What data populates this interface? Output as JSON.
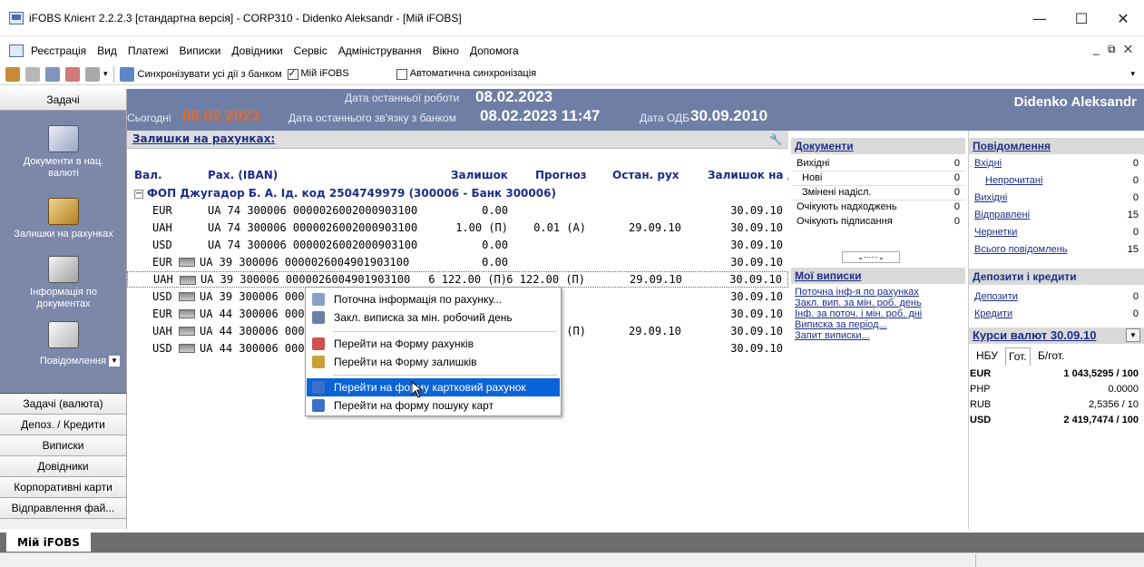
{
  "window": {
    "title": "iFOBS Клієнт 2.2.2.3 [стандартна версія] - CORP310 - Didenko Aleksandr - [Мій iFOBS]",
    "controls": [
      "—",
      "☐",
      "✕"
    ]
  },
  "menu": {
    "items": [
      "Реєстрація",
      "Вид",
      "Платежі",
      "Виписки",
      "Довідники",
      "Сервіс",
      "Адміністрування",
      "Вікно",
      "Допомога"
    ],
    "mdi": "_ ⧉ ✕"
  },
  "toolbar": {
    "sync_label": "Синхронізувати усі дії з банком",
    "my_ifobs_label": "Мій iFOBS",
    "auto_sync_label": "Автоматична синхронізація"
  },
  "sidebar": {
    "header": "Задачі",
    "nav": [
      {
        "label": "Документи в нац. валюті"
      },
      {
        "label": "Залишки на рахунках"
      },
      {
        "label": "Інформація по документах"
      },
      {
        "label": "Повідомлення"
      }
    ],
    "buttons": [
      "Задачі (валюта)",
      "Депоз. / Кредити",
      "Виписки",
      "Довідники",
      "Корпоративні карти",
      "Відправлення фай..."
    ]
  },
  "band": {
    "last_work_label": "Дата останньої роботи",
    "last_work": "08.02.2023",
    "today_label": "Сьогодні",
    "today": "08.02.2023",
    "last_conn_label": "Дата останнього зв'язку з банком",
    "last_conn": "08.02.2023 11:47",
    "odb_label": "Дата ОДБ",
    "odb": "30.09.2010",
    "user": "Didenko Aleksandr"
  },
  "balances": {
    "header": "Залишки на рахунках:",
    "columns": [
      "Вал.",
      "Рах. (IBAN)",
      "Залишок",
      "Прогноз",
      "Остан. рух",
      "Залишок на да"
    ],
    "group": "ФОП Джугадор Б. А. Ід. код 2504749979 (300006 - Банк 300006)",
    "rows": [
      {
        "cur": "EUR",
        "card": false,
        "iban": "UA 74 300006 0000026002000903100",
        "bal": "0.00",
        "fc": "",
        "last": "",
        "date": "30.09.10"
      },
      {
        "cur": "UAH",
        "card": false,
        "iban": "UA 74 300006 0000026002000903100",
        "bal": "1.00 (П)",
        "fc": "0.01 (А)",
        "last": "29.09.10",
        "date": "30.09.10"
      },
      {
        "cur": "USD",
        "card": false,
        "iban": "UA 74 300006 0000026002000903100",
        "bal": "0.00",
        "fc": "",
        "last": "",
        "date": "30.09.10"
      },
      {
        "cur": "EUR",
        "card": true,
        "iban": "UA 39 300006 0000026004901903100",
        "bal": "0.00",
        "fc": "",
        "last": "",
        "date": "30.09.10"
      },
      {
        "cur": "UAH",
        "card": true,
        "iban": "UA 39 300006 0000026004901903100",
        "bal": "6 122.00 (П)",
        "fc": "6 122.00 (П)",
        "last": "29.09.10",
        "date": "30.09.10"
      },
      {
        "cur": "USD",
        "card": true,
        "iban": "UA 39 300006 000",
        "bal": "",
        "fc": "",
        "last": "",
        "date": "30.09.10"
      },
      {
        "cur": "EUR",
        "card": true,
        "iban": "UA 44 300006 000",
        "bal": "",
        "fc": "",
        "last": "",
        "date": "30.09.10"
      },
      {
        "cur": "UAH",
        "card": true,
        "iban": "UA 44 300006 000",
        "bal": "",
        "fc": "0 (П)",
        "last": "29.09.10",
        "date": "30.09.10"
      },
      {
        "cur": "USD",
        "card": true,
        "iban": "UA 44 300006 000",
        "bal": "",
        "fc": "",
        "last": "",
        "date": "30.09.10"
      }
    ]
  },
  "context_menu": {
    "items": [
      {
        "label": "Поточна інформація по рахунку...",
        "color": "#8aa0c8"
      },
      {
        "label": "Закл. виписка за мін. робочий день",
        "color": "#6b7fa8"
      },
      {
        "label": "Перейти на Форму рахунків",
        "color": "#d05050"
      },
      {
        "label": "Перейти на Форму залишків",
        "color": "#c9a23a"
      },
      {
        "label": "Перейти на форму картковий рахунок",
        "color": "#3b6fc8"
      },
      {
        "label": "Перейти на форму пошуку карт",
        "color": "#3b6fc8"
      }
    ]
  },
  "documents": {
    "header": "Документи",
    "rows": [
      {
        "k": "Вихідні",
        "v": "0"
      },
      {
        "k": "Нові",
        "v": "0"
      },
      {
        "k": "Змінені надісл.",
        "v": "0"
      },
      {
        "k": "Очікують надходжень",
        "v": "0"
      },
      {
        "k": "Очікують підписання",
        "v": "0"
      }
    ],
    "expander": "⌄⋯⋯⌄"
  },
  "statements": {
    "header": "Мої виписки",
    "links": [
      "Поточна інф-я по рахунках",
      "Закл. вип. за мін. роб. день",
      "Інф. за поточ. і мін. роб. дні",
      "Виписка за період...",
      "Запит виписки..."
    ]
  },
  "messages": {
    "header": "Повідомлення",
    "rows": [
      {
        "k": "Вхідні",
        "v": "0"
      },
      {
        "k": "Непрочитані",
        "v": "0"
      },
      {
        "k": "Вихідні",
        "v": "0"
      },
      {
        "k": "Відправлені",
        "v": "15"
      },
      {
        "k": "Чернетки",
        "v": "0"
      },
      {
        "k": "Всього повідомлень",
        "v": "15"
      }
    ]
  },
  "deposits": {
    "header": "Депозити і кредити",
    "rows": [
      {
        "k": "Депозити",
        "v": "0"
      },
      {
        "k": "Кредити",
        "v": "0"
      }
    ]
  },
  "rates": {
    "header": "Курси валют 30.09.10",
    "tabs": [
      "НБУ",
      "Гот.",
      "Б/гот."
    ],
    "rows": [
      {
        "k": "EUR",
        "v": "1 043,5295 / 100",
        "bold": true
      },
      {
        "k": "PHP",
        "v": "0.0000",
        "bold": false
      },
      {
        "k": "RUB",
        "v": "2,5356 / 10",
        "bold": false
      },
      {
        "k": "USD",
        "v": "2 419,7474 / 100",
        "bold": true
      }
    ]
  },
  "bottom_tab": "Мій iFOBS"
}
